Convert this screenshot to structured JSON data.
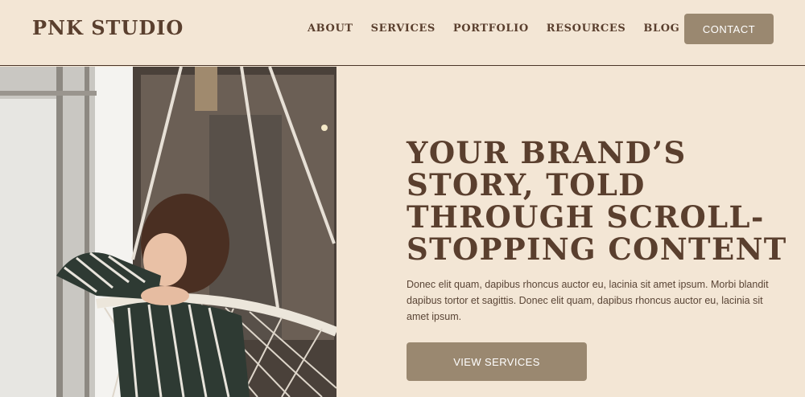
{
  "brand": {
    "logo": "PNK STUDIO"
  },
  "nav": {
    "items": [
      "ABOUT",
      "SERVICES",
      "PORTFOLIO",
      "RESOURCES",
      "BLOG"
    ],
    "contact_label": "CONTACT"
  },
  "hero": {
    "headline_lines": [
      "YOUR BRAND’S",
      "STORY, TOLD",
      "THROUGH SCROLL-",
      "STOPPING CONTENT"
    ],
    "body": "Donec elit quam, dapibus rhoncus auctor eu, lacinia sit amet ipsum. Morbi blandit dapibus tortor et sagittis. Donec elit quam, dapibus rhoncus auctor eu, lacinia sit amet ipsum.",
    "cta_label": "VIEW SERVICES"
  },
  "colors": {
    "background": "#f3e6d5",
    "text": "#5a3f2e",
    "button": "#9a8870"
  }
}
